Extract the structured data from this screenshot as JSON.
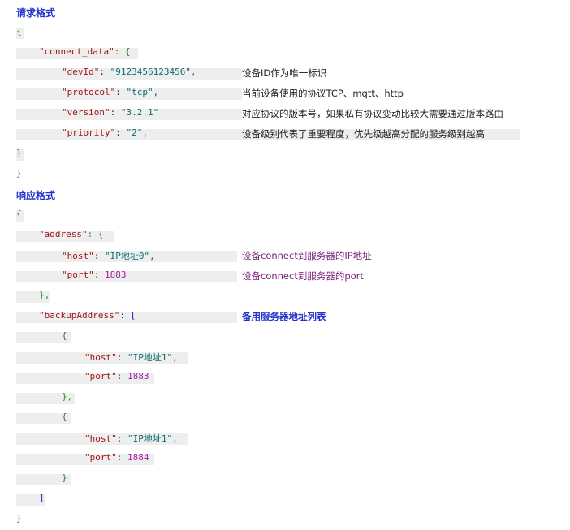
{
  "headings": {
    "request": "请求格式",
    "response": "响应格式"
  },
  "request": {
    "open_brace": "{",
    "connect_data_key": "\"connect_data\"",
    "colon_open": ": {",
    "fields": [
      {
        "key": "\"devId\"",
        "value": "\"9123456123456\",",
        "comment": "设备ID作为唯一标识"
      },
      {
        "key": "\"protocol\"",
        "value": "\"tcp\",",
        "comment": "当前设备使用的协议TCP、mqtt、http"
      },
      {
        "key": "\"version\"",
        "value": "\"3.2.1\"",
        "comment": "对应协议的版本号，如果私有协议变动比较大需要通过版本路由"
      },
      {
        "key": "\"priority\"",
        "value": "\"2\",",
        "comment": "设备级别代表了重要程度，优先级越高分配的服务级别越高"
      }
    ],
    "inner_close": "}",
    "close_brace": "}"
  },
  "response": {
    "open_brace": "{",
    "address_key": "\"address\"",
    "address_open": ": {",
    "address_host_key": "\"host\"",
    "address_host_value": "\"IP地址0\",",
    "address_host_comment": "设备connect到服务器的IP地址",
    "address_port_key": "\"port\"",
    "address_port_value": "1883",
    "address_port_comment": "设备connect到服务器的port",
    "address_close": "},",
    "backup_key": "\"backupAddress\"",
    "backup_open": ": [",
    "backup_comment": "备用服务器地址列表",
    "entries": [
      {
        "open": "{",
        "host_key": "\"host\"",
        "host_value": "\"IP地址1\",",
        "port_key": "\"port\"",
        "port_value": "1883",
        "close": "},"
      },
      {
        "open": "{",
        "host_key": "\"host\"",
        "host_value": "\"IP地址1\",",
        "port_key": "\"port\"",
        "port_value": "1884",
        "close": "}"
      }
    ],
    "backup_close": "]",
    "close_brace": "}"
  }
}
